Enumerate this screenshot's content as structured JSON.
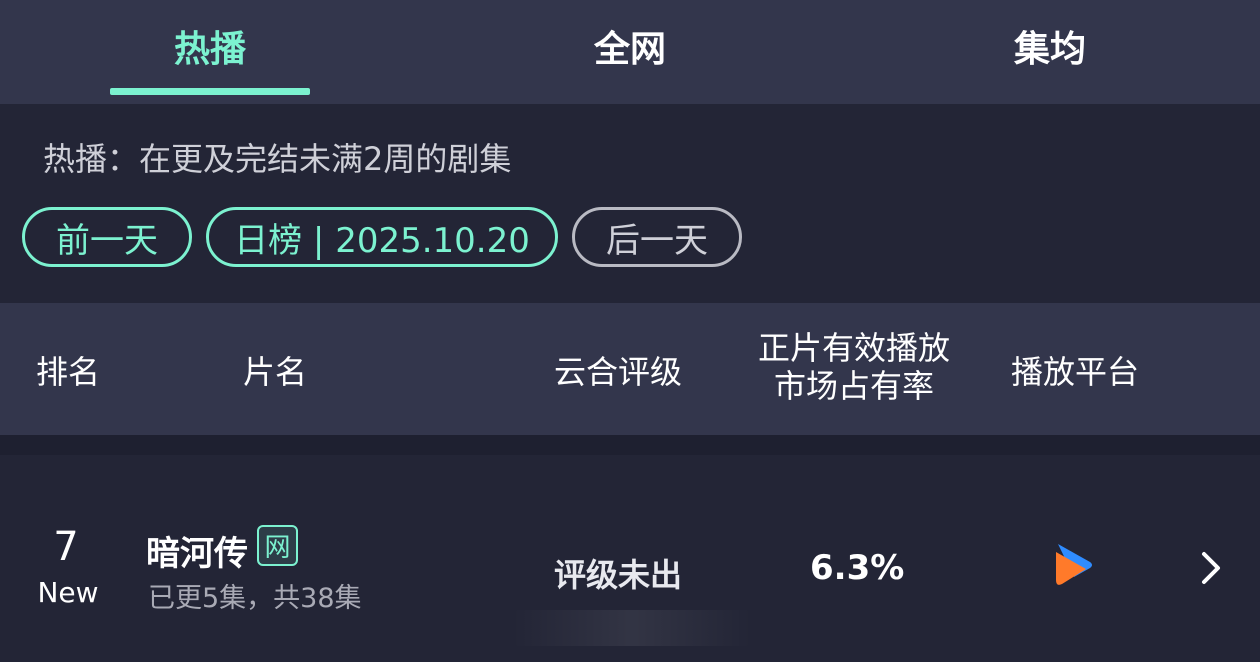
{
  "tabs": [
    {
      "label": "热播",
      "active": true
    },
    {
      "label": "全网",
      "active": false
    },
    {
      "label": "集均",
      "active": false
    }
  ],
  "description": "热播：在更及完结未满2周的剧集",
  "date_nav": {
    "prev_label": "前一天",
    "current_label": "日榜 | 2025.10.20",
    "next_label": "后一天"
  },
  "table": {
    "headers": {
      "rank": "排名",
      "title": "片名",
      "rating": "云合评级",
      "share_line1": "正片有效播放",
      "share_line2": "市场占有率",
      "platform": "播放平台"
    },
    "rows": [
      {
        "rank": "7",
        "rank_status": "New",
        "title": "暗河传",
        "badge": "网",
        "episodes": "已更5集，共38集",
        "rating": "评级未出",
        "share": "6.3%",
        "platform_icon": "youku-platform-icon"
      }
    ]
  },
  "colors": {
    "accent": "#7cf2d0",
    "background": "#232536",
    "header_bg": "#33364c",
    "text": "#ffffff",
    "muted_text": "#a9aab5",
    "platform_blue": "#2f8cff",
    "platform_orange": "#ff7a2a"
  }
}
